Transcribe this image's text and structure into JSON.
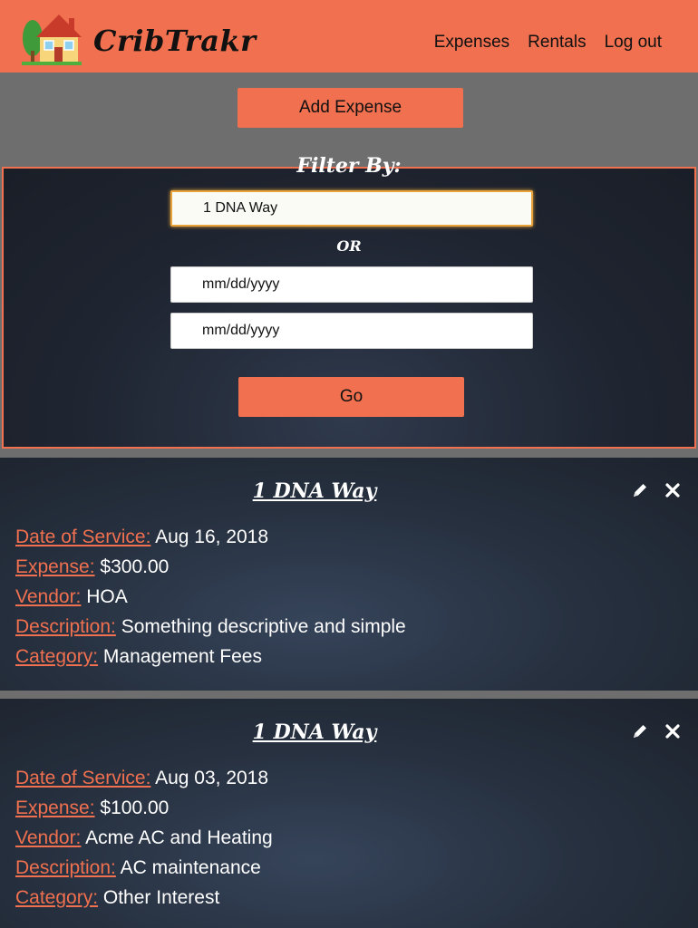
{
  "nav": {
    "brand": "CribTrakr",
    "links": [
      "Expenses",
      "Rentals",
      "Log out"
    ]
  },
  "toolbar": {
    "add_label": "Add Expense"
  },
  "filter": {
    "heading": "Filter By:",
    "property_value": "1 DNA Way",
    "or_label": "OR",
    "start_date": "mm/dd/yyyy",
    "end_date": "mm/dd/yyyy",
    "go_label": "Go"
  },
  "labels": {
    "date": "Date of Service:",
    "expense": "Expense:",
    "vendor": "Vendor:",
    "description": "Description:",
    "category": "Category:"
  },
  "expenses": [
    {
      "property": "1 DNA Way",
      "date": "Aug 16, 2018",
      "amount": "$300.00",
      "vendor": "HOA",
      "description": "Something descriptive and simple",
      "category": "Management Fees"
    },
    {
      "property": "1 DNA Way",
      "date": "Aug 03, 2018",
      "amount": "$100.00",
      "vendor": "Acme AC and Heating",
      "description": "AC maintenance",
      "category": "Other Interest"
    }
  ],
  "icons": {
    "logo": "house-icon",
    "edit": "pencil-icon",
    "delete": "close-icon"
  },
  "colors": {
    "accent": "#f0704f",
    "toolbar": "#6e6e6e",
    "panel": "#1f2531"
  }
}
